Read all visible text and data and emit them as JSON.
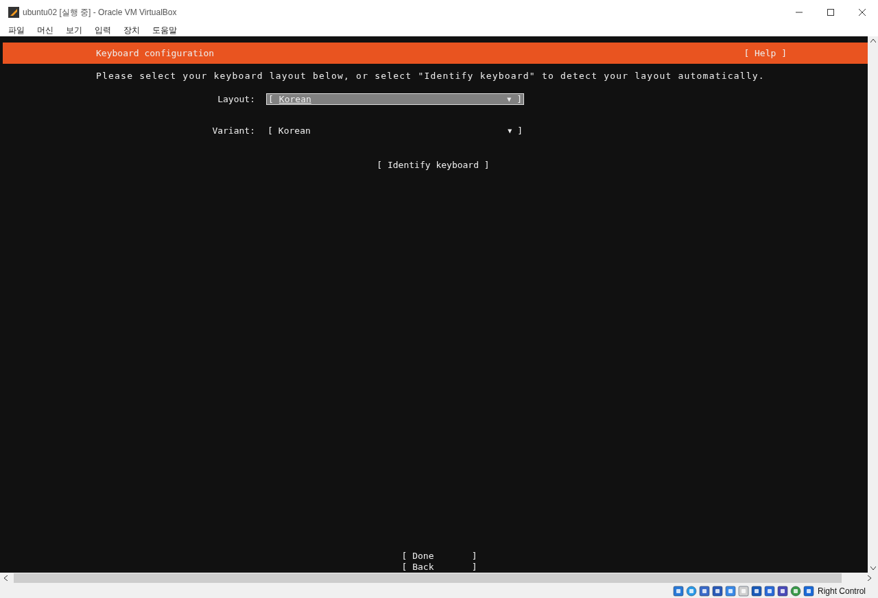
{
  "window": {
    "title": "ubuntu02 [실행 중] - Oracle VM VirtualBox"
  },
  "menu": [
    "파일",
    "머신",
    "보기",
    "입력",
    "장치",
    "도움말"
  ],
  "screen": {
    "header": {
      "title": "Keyboard configuration",
      "help": "[ Help ]"
    },
    "instruction": "Please select your keyboard layout below, or select \"Identify keyboard\" to detect your layout automatically.",
    "fields": [
      {
        "label": "Layout:",
        "open": "[",
        "value": "Korean",
        "arrow": "▼",
        "close": "]",
        "selected": true
      },
      {
        "label": "Variant:",
        "open": "[",
        "value": "Korean",
        "arrow": "▼",
        "close": "]",
        "selected": false
      }
    ],
    "identify": "[ Identify keyboard ]",
    "buttons": [
      {
        "open": "[",
        "label": "Done",
        "close": "]"
      },
      {
        "open": "[",
        "label": "Back",
        "close": "]"
      }
    ]
  },
  "status_bar": {
    "host_key": "Right Control"
  }
}
